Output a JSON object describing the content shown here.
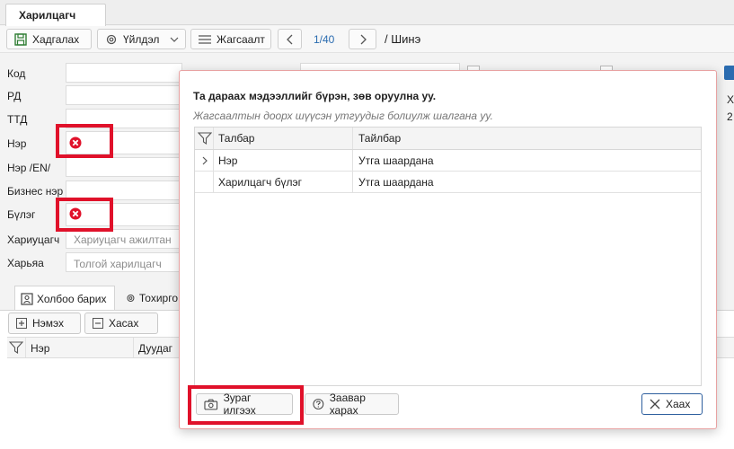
{
  "tabs": {
    "active": "Харилцагч"
  },
  "toolbar": {
    "save": "Хадгалах",
    "actions": "Үйлдэл",
    "list": "Жагсаалт",
    "page": "1/40",
    "mode": "/ Шинэ"
  },
  "form": {
    "code": "Код",
    "rd": "РД",
    "ttd": "ТТД",
    "name": "Нэр",
    "name_en": "Нэр /EN/",
    "business_name": "Бизнес нэр",
    "group": "Бүлэг",
    "owner": "Хариуцагч",
    "owner_placeholder": "Хариуцагч ажилтан",
    "parent": "Харьяа",
    "parent_placeholder": "Толгой харилцагч"
  },
  "right_partial": {
    "line1": "Х",
    "line2": "2"
  },
  "subtabs": {
    "contacts": "Холбоо барих",
    "settings": "Тохирго"
  },
  "panel": {
    "add": "Нэмэх",
    "remove": "Хасах",
    "col_name": "Нэр",
    "col_phone": "Дуудаг"
  },
  "dialog": {
    "title": "Та дараах мэдээллийг бүрэн, зөв оруулна уу.",
    "subtitle": "Жагсаалтын доорх шүүсэн утгуудыг болиулж шалгана уу.",
    "col_field": "Талбар",
    "col_desc": "Тайлбар",
    "rows": [
      {
        "field": "Нэр",
        "desc": "Утга шаардана"
      },
      {
        "field": "Харилцагч бүлэг",
        "desc": "Утга шаардана"
      }
    ],
    "screenshot_btn": "Зураг илгээх",
    "help_btn": "Заавар харах",
    "close_btn": "Хаах"
  },
  "colors": {
    "error_red": "#e0112a",
    "accent_blue": "#2b6cb0"
  }
}
